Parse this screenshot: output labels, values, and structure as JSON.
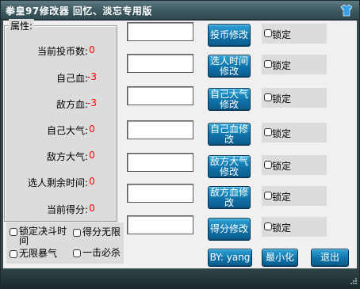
{
  "window": {
    "title": "拳皇97修改器  回忆、淡忘专用版"
  },
  "attributes": {
    "group_title": "属性:",
    "rows": [
      {
        "label": "当前投币数:",
        "value": "0"
      },
      {
        "label": "自己血:",
        "value": "-3"
      },
      {
        "label": "敌方血:",
        "value": "-3"
      },
      {
        "label": "自己大气:",
        "value": "0"
      },
      {
        "label": "敌方大气:",
        "value": "0"
      },
      {
        "label": "选人剩余时间:",
        "value": "0"
      },
      {
        "label": "当前得分:",
        "value": "0"
      }
    ]
  },
  "modifiers": [
    {
      "input_value": "",
      "button_label": "投币修改",
      "lock_label": "锁定"
    },
    {
      "input_value": "",
      "button_label": "选人时间修改",
      "lock_label": "锁定"
    },
    {
      "input_value": "",
      "button_label": "自己大气修改",
      "lock_label": "锁定"
    },
    {
      "input_value": "",
      "button_label": "自己血修改",
      "lock_label": "锁定"
    },
    {
      "input_value": "",
      "button_label": "敌方大气修改",
      "lock_label": "锁定"
    },
    {
      "input_value": "",
      "button_label": "敌方血修改",
      "lock_label": "锁定"
    },
    {
      "input_value": "",
      "button_label": "得分修改",
      "lock_label": "锁定"
    }
  ],
  "options": {
    "lock_fight_time": "锁定决斗时间",
    "infinite_score": "得分无限",
    "infinite_rage": "无限暴气",
    "one_hit_kill": "一击必杀"
  },
  "footer": {
    "author_button": "BY: yang",
    "minimize_button": "最小化",
    "exit_button": "退出"
  },
  "colors": {
    "value_text": "#ff0000",
    "button_fill": "#1283bd",
    "title_bar": "#3d5960"
  }
}
